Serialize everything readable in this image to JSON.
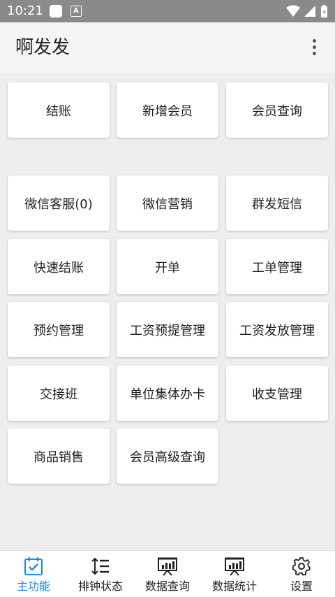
{
  "status": {
    "time": "10:21"
  },
  "app": {
    "title": "啊发发"
  },
  "top_tiles": [
    {
      "label": "结账"
    },
    {
      "label": "新增会员"
    },
    {
      "label": "会员查询"
    }
  ],
  "tiles": [
    {
      "label": "微信客服(0)"
    },
    {
      "label": "微信营销"
    },
    {
      "label": "群发短信"
    },
    {
      "label": "快速结账"
    },
    {
      "label": "开单"
    },
    {
      "label": "工单管理"
    },
    {
      "label": "预约管理"
    },
    {
      "label": "工资预提管理"
    },
    {
      "label": "工资发放管理"
    },
    {
      "label": "交接班"
    },
    {
      "label": "单位集体办卡"
    },
    {
      "label": "收支管理"
    },
    {
      "label": "商品销售"
    },
    {
      "label": "会员高级查询"
    }
  ],
  "bottom_nav": [
    {
      "label": "主功能",
      "icon": "calendar-check-icon",
      "active": true
    },
    {
      "label": "排钟状态",
      "icon": "sort-list-icon",
      "active": false
    },
    {
      "label": "数据查询",
      "icon": "presentation-chart-icon",
      "active": false
    },
    {
      "label": "数据统计",
      "icon": "presentation-chart-icon",
      "active": false
    },
    {
      "label": "设置",
      "icon": "gear-icon",
      "active": false
    }
  ],
  "colors": {
    "accent": "#1e88e5",
    "statusbar": "#8a8a8a",
    "background": "#eeeeee"
  }
}
